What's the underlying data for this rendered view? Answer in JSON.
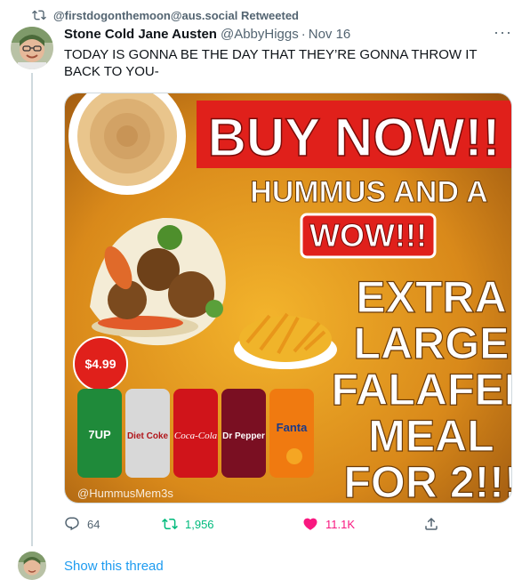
{
  "retweet": {
    "text": "@firstdogonthemoon@aus.social Retweeted"
  },
  "tweet": {
    "display_name": "Stone Cold Jane Austen",
    "handle": "@AbbyHiggs",
    "separator": "·",
    "timestamp": "Nov 16",
    "more": "···",
    "text": "TODAY IS GONNA BE THE DAY THAT THEY’RE GONNA THROW IT BACK TO YOU-"
  },
  "media": {
    "buy_now": "BUY NOW!!",
    "hummus_and_a": "HUMMUS AND A",
    "wow": "WOW!!!",
    "extra": "EXTRA",
    "large": "LARGE",
    "falafel": "FALAFEL",
    "meal": "MEAL",
    "for_2": "FOR 2!!!",
    "price": "$4.99",
    "watermark": "@HummusMem3s",
    "cans": [
      "7UP",
      "Diet Coke",
      "Coca-Cola",
      "Dr Pepper",
      "Fanta"
    ]
  },
  "actions": {
    "replies": "64",
    "retweets": "1,956",
    "likes": "11.1K"
  },
  "thread": {
    "show_label": "Show this thread"
  },
  "colors": {
    "accent": "#1d9bf0",
    "retweet_green": "#00ba7c",
    "like_pink": "#f91880",
    "muted": "#536471",
    "poster_red": "#e0201b",
    "poster_orange": "#e98a10"
  }
}
